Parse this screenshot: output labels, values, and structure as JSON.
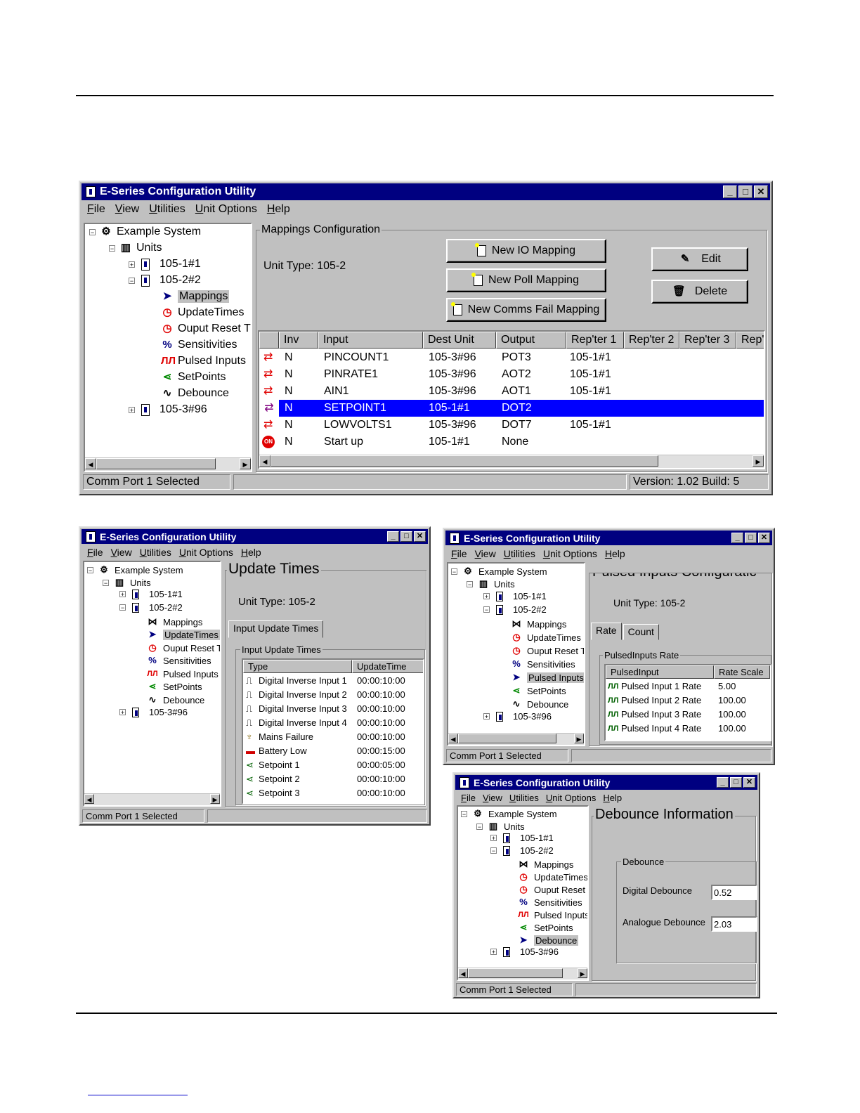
{
  "tree": {
    "root": "Example System",
    "units": "Units",
    "unit1": "105-1#1",
    "unit2": "105-2#2",
    "unit3": "105-3#96",
    "children": [
      "Mappings",
      "UpdateTimes",
      "Ouput Reset T",
      "Sensitivities",
      "Pulsed Inputs",
      "SetPoints",
      "Debounce"
    ]
  },
  "menu": [
    "File",
    "View",
    "Utilities",
    "Unit Options",
    "Help"
  ],
  "title": "E-Series Configuration Utility",
  "status": {
    "port": "Comm Port 1 Selected",
    "version": "Version: 1.02 Build: 5"
  },
  "mappings": {
    "group_label": "Mappings Configuration",
    "unit_type": "Unit Type:  105-2",
    "btn_new_io": "New IO Mapping",
    "btn_new_poll": "New Poll Mapping",
    "btn_new_comms": "New Comms Fail Mapping",
    "btn_edit": "Edit",
    "btn_delete": "Delete",
    "columns": [
      "Inv",
      "Input",
      "Dest Unit",
      "Output",
      "Rep'ter 1",
      "Rep'ter 2",
      "Rep'ter 3",
      "Rep't"
    ],
    "rows": [
      {
        "inv": "N",
        "input": "PINCOUNT1",
        "dest": "105-3#96",
        "output": "POT3",
        "rep1": "105-1#1"
      },
      {
        "inv": "N",
        "input": "PINRATE1",
        "dest": "105-3#96",
        "output": "AOT2",
        "rep1": "105-1#1"
      },
      {
        "inv": "N",
        "input": "AIN1",
        "dest": "105-3#96",
        "output": "AOT1",
        "rep1": "105-1#1"
      },
      {
        "inv": "N",
        "input": "SETPOINT1",
        "dest": "105-1#1",
        "output": "DOT2",
        "rep1": ""
      },
      {
        "inv": "N",
        "input": "LOWVOLTS1",
        "dest": "105-3#96",
        "output": "DOT7",
        "rep1": "105-1#1"
      },
      {
        "inv": "N",
        "input": "Start up",
        "dest": "105-1#1",
        "output": "None",
        "rep1": ""
      }
    ],
    "selected_row": 3,
    "on_badge": "ON"
  },
  "update_times": {
    "heading": "Update Times",
    "unit_type": "Unit Type:   105-2",
    "tab": "Input Update Times",
    "group_label": "Input Update Times",
    "columns": [
      "Type",
      "UpdateTime"
    ],
    "rows": [
      {
        "type": "Digital Inverse Input 1",
        "time": "00:00:10:00"
      },
      {
        "type": "Digital Inverse Input 2",
        "time": "00:00:10:00"
      },
      {
        "type": "Digital Inverse Input 3",
        "time": "00:00:10:00"
      },
      {
        "type": "Digital Inverse Input 4",
        "time": "00:00:10:00"
      },
      {
        "type": "Mains Failure",
        "time": "00:00:10:00"
      },
      {
        "type": "Battery Low",
        "time": "00:00:15:00"
      },
      {
        "type": "Setpoint 1",
        "time": "00:00:05:00"
      },
      {
        "type": "Setpoint 2",
        "time": "00:00:10:00"
      },
      {
        "type": "Setpoint 3",
        "time": "00:00:10:00"
      }
    ]
  },
  "pulsed": {
    "heading": "Pulsed Inputs Configuratic",
    "unit_type": "Unit Type:  105-2",
    "tab_rate": "Rate",
    "tab_count": "Count",
    "group_label": "PulsedInputs Rate",
    "columns": [
      "PulsedInput",
      "Rate Scale"
    ],
    "rows": [
      {
        "name": "Pulsed Input 1 Rate",
        "scale": "5.00"
      },
      {
        "name": "Pulsed Input 2 Rate",
        "scale": "100.00"
      },
      {
        "name": "Pulsed Input 3 Rate",
        "scale": "100.00"
      },
      {
        "name": "Pulsed Input 4 Rate",
        "scale": "100.00"
      }
    ]
  },
  "debounce": {
    "heading": "Debounce Information",
    "group_label": "Debounce",
    "digital_label": "Digital Debounce",
    "digital_value": "0.52",
    "analogue_label": "Analogue Debounce",
    "analogue_value": "2.03"
  }
}
